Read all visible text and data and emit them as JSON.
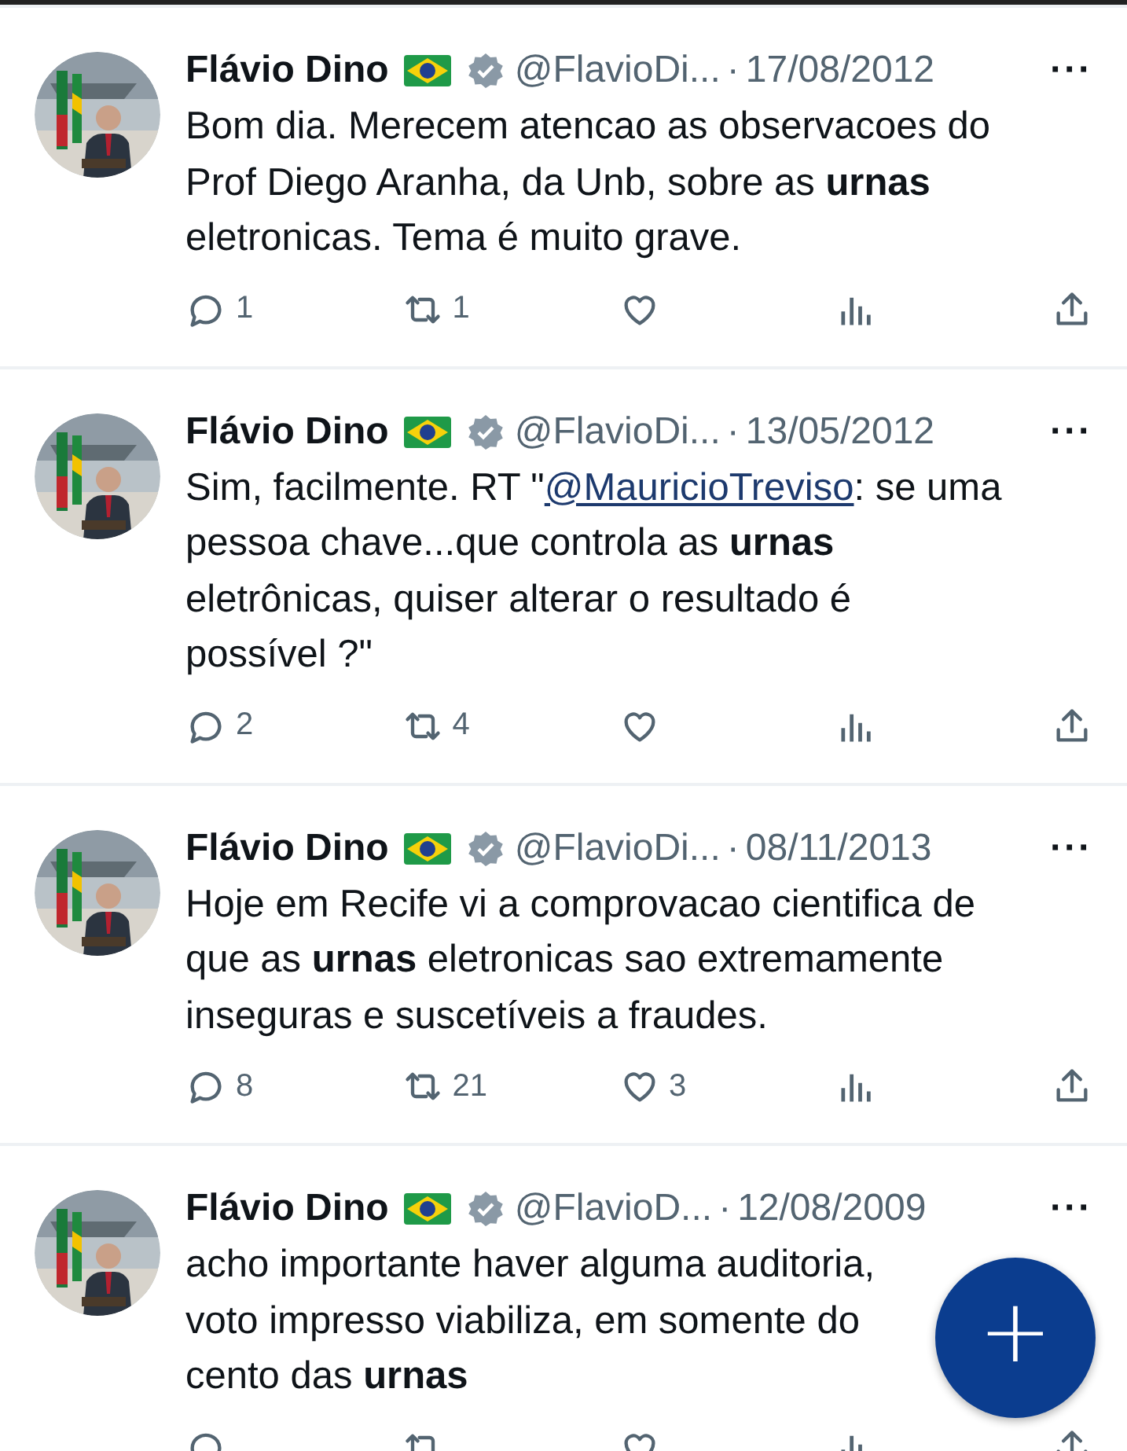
{
  "tweets": [
    {
      "name": "Flávio Dino",
      "handle": "@FlavioDi...",
      "separator": "·",
      "date": "17/08/2012",
      "more": "···",
      "lines": [
        [
          {
            "kind": "text",
            "text": "Bom dia. Merecem atencao as observacoes do"
          }
        ],
        [
          {
            "kind": "text",
            "text": "Prof Diego Aranha, da Unb, sobre as **urnas**"
          }
        ],
        [
          {
            "kind": "text",
            "text": "eletronicas. Tema é muito grave."
          }
        ]
      ],
      "actions": [
        {
          "kind": "reply",
          "count": "1"
        },
        {
          "kind": "repost",
          "count": "1"
        },
        {
          "kind": "like"
        },
        {
          "kind": "views"
        },
        {
          "kind": "share"
        }
      ]
    },
    {
      "name": "Flávio Dino",
      "handle": "@FlavioDi...",
      "separator": "·",
      "date": "13/05/2012",
      "more": "···",
      "lines": [
        [
          {
            "kind": "text",
            "text": "Sim, facilmente. RT \""
          },
          {
            "kind": "mention",
            "text": "@MauricioTreviso"
          },
          {
            "kind": "text",
            "text": ": se uma"
          }
        ],
        [
          {
            "kind": "text",
            "text": "pessoa chave...que controla as **urnas**"
          }
        ],
        [
          {
            "kind": "text",
            "text": "eletrônicas, quiser alterar o resultado é"
          }
        ],
        [
          {
            "kind": "text",
            "text": "possível ?\""
          }
        ]
      ],
      "actions": [
        {
          "kind": "reply",
          "count": "2"
        },
        {
          "kind": "repost",
          "count": "4"
        },
        {
          "kind": "like"
        },
        {
          "kind": "views"
        },
        {
          "kind": "share"
        }
      ]
    },
    {
      "name": "Flávio Dino",
      "handle": "@FlavioDi...",
      "separator": "·",
      "date": "08/11/2013",
      "more": "···",
      "lines": [
        [
          {
            "kind": "text",
            "text": "Hoje em Recife vi a comprovacao cientifica de"
          }
        ],
        [
          {
            "kind": "text",
            "text": "que as **urnas** eletronicas sao extremamente"
          }
        ],
        [
          {
            "kind": "text",
            "text": "inseguras e suscetíveis a fraudes."
          }
        ]
      ],
      "actions": [
        {
          "kind": "reply",
          "count": "8"
        },
        {
          "kind": "repost",
          "count": "21"
        },
        {
          "kind": "like",
          "count": "3"
        },
        {
          "kind": "views"
        },
        {
          "kind": "share"
        }
      ]
    },
    {
      "name": "Flávio Dino",
      "handle": "@FlavioD...",
      "separator": "·",
      "date": "12/08/2009",
      "more": "···",
      "lines": [
        [
          {
            "kind": "text",
            "text": "acho importante haver alguma auditoria,"
          }
        ],
        [
          {
            "kind": "text",
            "text": "voto impresso viabiliza, em somente do"
          }
        ],
        [
          {
            "kind": "text",
            "text": "cento das **urnas**"
          }
        ]
      ],
      "actions": [
        {
          "kind": "reply"
        },
        {
          "kind": "repost"
        },
        {
          "kind": "like"
        },
        {
          "kind": "views"
        },
        {
          "kind": "share"
        }
      ]
    }
  ],
  "fab": {
    "label": "+"
  }
}
